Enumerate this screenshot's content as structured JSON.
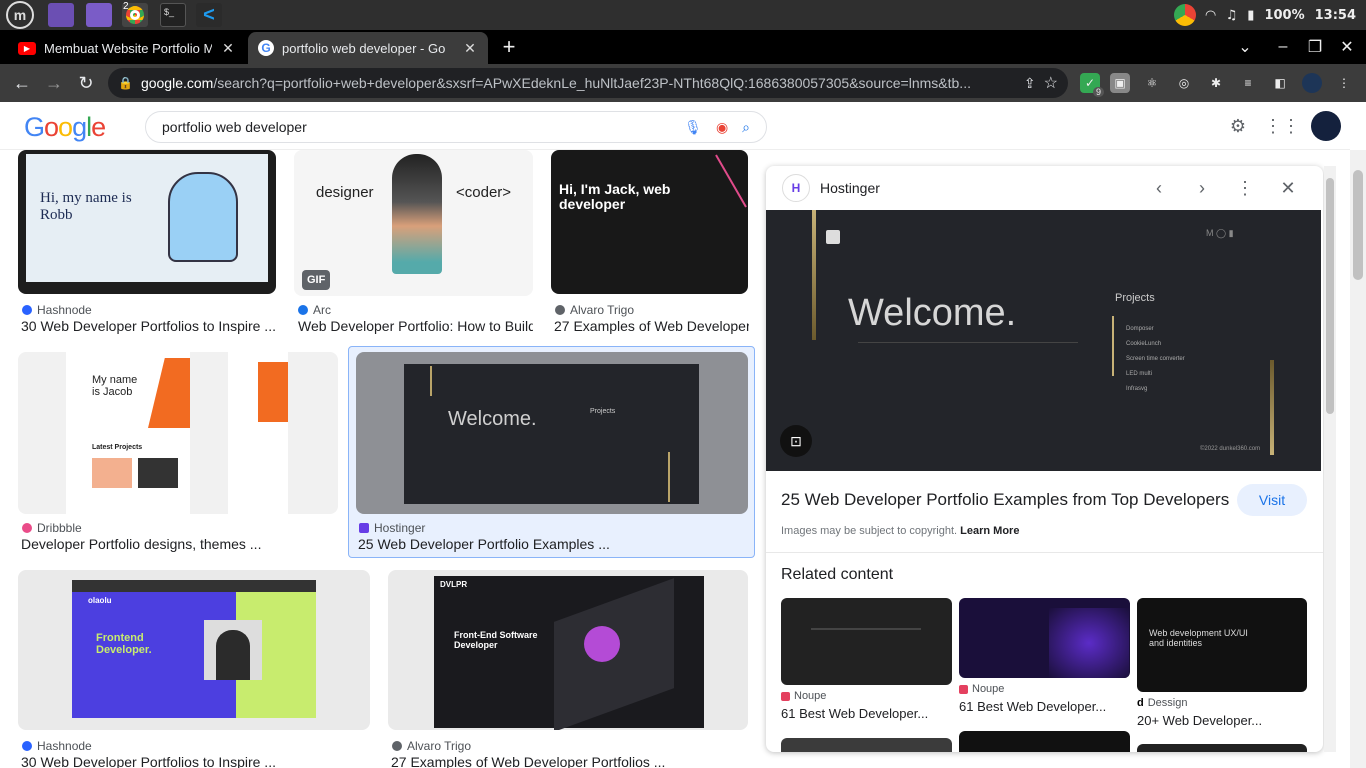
{
  "taskbar": {
    "battery": "100%",
    "time": "13:54",
    "chrome_badge": "2"
  },
  "tabs": [
    {
      "title": "Membuat Website Portfolio M",
      "icon": "youtube-icon",
      "active": false
    },
    {
      "title": "portfolio web developer - Go",
      "icon": "google-icon",
      "active": true
    }
  ],
  "omnibox": {
    "domain": "google.com",
    "path": "/search?q=portfolio+web+developer&sxsrf=APwXEdeknLe_huNltJaef23P-NTht68QlQ:1686380057305&source=lnms&tb..."
  },
  "extensions": {
    "badge": "9"
  },
  "search": {
    "logo": "Google",
    "query": "portfolio web developer"
  },
  "results": [
    {
      "source": "Hashnode",
      "title": "30 Web Developer Portfolios to Inspire ...",
      "thumb_text": "Hi, my name is Robb",
      "fav": "#2962ff"
    },
    {
      "source": "Arc",
      "title": "Web Developer Portfolio: How to Build...",
      "thumb_text_1": "designer",
      "thumb_text_2": "<coder>",
      "badge": "GIF",
      "fav": "#1a73e8"
    },
    {
      "source": "Alvaro Trigo",
      "title": "27 Examples of Web Developer...",
      "thumb_text": "Hi, I'm Jack, web developer",
      "fav": "#5f6368"
    },
    {
      "source": "Dribbble",
      "title": "Developer Portfolio designs, themes ...",
      "thumb_text": "My name is Jacob",
      "thumb_sub": "Latest Projects",
      "fav": "#ea4c89"
    },
    {
      "source": "Hostinger",
      "title": "25 Web Developer Portfolio Examples ...",
      "thumb_text": "Welcome.",
      "thumb_sub": "Projects",
      "fav": "#673de6"
    },
    {
      "source": "Hashnode",
      "title": "30 Web Developer Portfolios to Inspire ...",
      "thumb_text": "Frontend Developer.",
      "thumb_logo": "olaolu",
      "fav": "#2962ff"
    },
    {
      "source": "Alvaro Trigo",
      "title": "27 Examples of Web Developer Portfolios ...",
      "thumb_text": "Front-End Software Developer",
      "thumb_logo": "DVLPR",
      "fav": "#5f6368"
    }
  ],
  "panel": {
    "source": "Hostinger",
    "preview_heading": "Welcome.",
    "preview_projects": "Projects",
    "preview_links": [
      "Domposer",
      "CookieLunch",
      "Screen time converter",
      "LED multi",
      "Infrasvg"
    ],
    "preview_footer": "©2022 dunkel360.com",
    "title": "25 Web Developer Portfolio Examples from Top Developers",
    "visit": "Visit",
    "copyright": "Images may be subject to copyright.",
    "learn_more": "Learn More",
    "related_heading": "Related content",
    "related": [
      {
        "source": "Noupe",
        "title": "61 Best Web Developer..."
      },
      {
        "source": "Noupe",
        "title": "61 Best Web Developer..."
      },
      {
        "source": "Dessign",
        "title": "20+ Web Developer...",
        "thumb_text": "Web development UX/UI and identities"
      }
    ]
  },
  "colors": {
    "accent": "#1a73e8",
    "selected": "#e8f0fe"
  }
}
